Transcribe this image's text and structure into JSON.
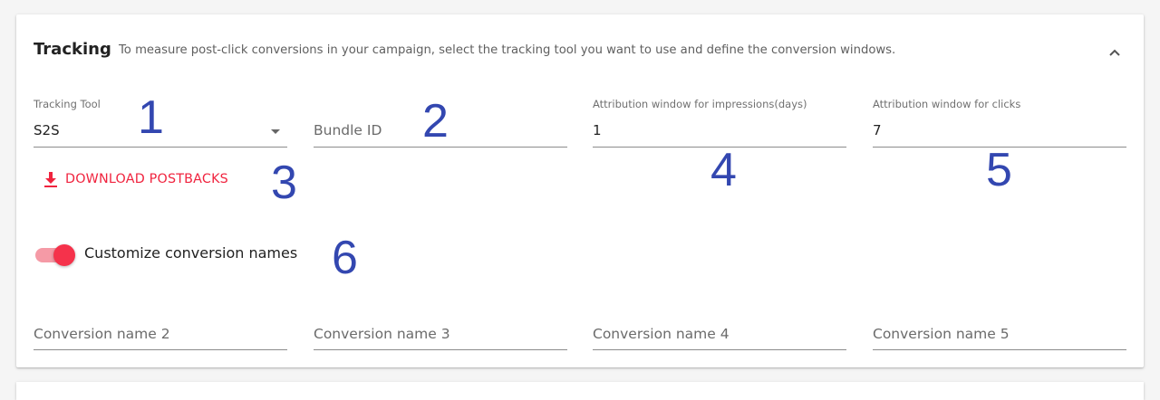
{
  "section": {
    "title": "Tracking",
    "description": "To measure post-click conversions in your campaign, select the tracking tool you want to use and define the conversion windows.",
    "collapse_icon": "chevron-up-icon"
  },
  "fields": {
    "tracking_tool": {
      "label": "Tracking Tool",
      "value": "S2S"
    },
    "bundle_id": {
      "placeholder": "Bundle ID"
    },
    "attr_impressions": {
      "label": "Attribution window for impressions(days)",
      "value": "1"
    },
    "attr_clicks": {
      "label": "Attribution window for clicks",
      "value": "7"
    }
  },
  "download": {
    "label": "DOWNLOAD POSTBACKS",
    "icon": "download-icon"
  },
  "toggle": {
    "label": "Customize conversion names",
    "on": true
  },
  "conversion_names": [
    {
      "placeholder": "Conversion name 2"
    },
    {
      "placeholder": "Conversion name 3"
    },
    {
      "placeholder": "Conversion name 4"
    },
    {
      "placeholder": "Conversion name 5"
    }
  ],
  "annotations": [
    "1",
    "2",
    "3",
    "4",
    "5",
    "6"
  ],
  "colors": {
    "accent": "#f0233e",
    "toggle_thumb": "#f5324b",
    "toggle_track": "#f59aa6",
    "annotation": "#3347b0"
  }
}
